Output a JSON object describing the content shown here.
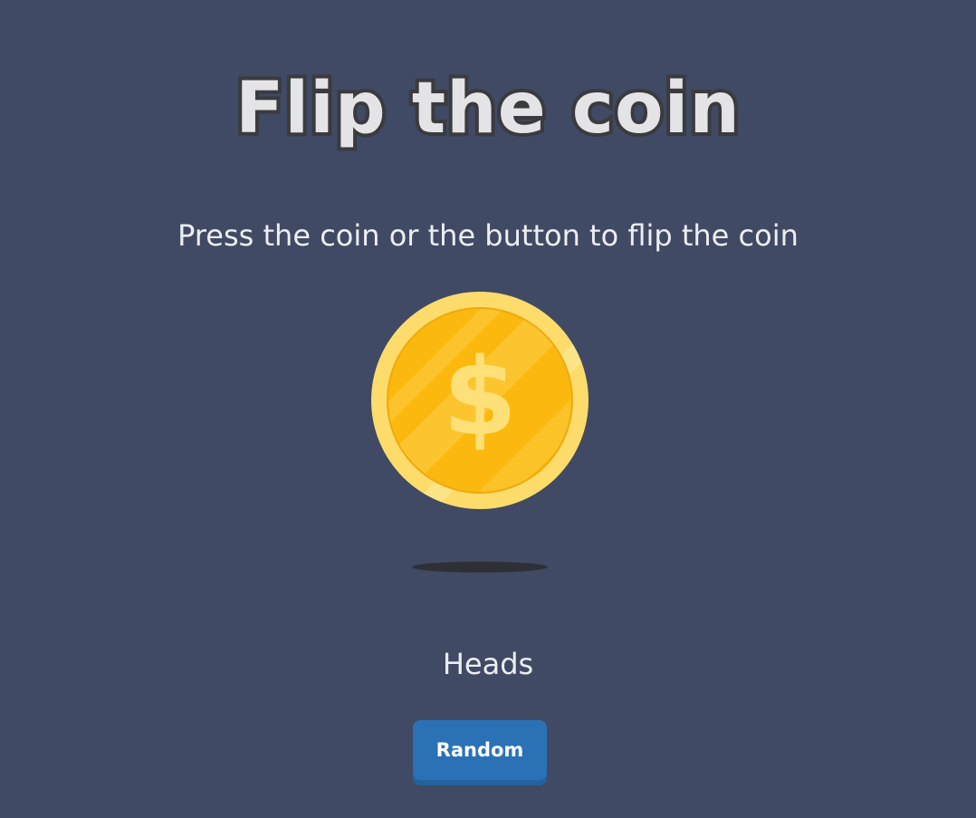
{
  "header": {
    "title": "Flip the coin",
    "subtitle": "Press the coin or the button to flip the coin"
  },
  "coin": {
    "icon": "dollar-coin-icon",
    "symbol": "$",
    "colors": {
      "rim": "#fddc6b",
      "face": "#fbb90f",
      "stripe": "#fcc735",
      "symbol": "#fde077"
    }
  },
  "result": {
    "text": "Heads"
  },
  "controls": {
    "random_label": "Random"
  },
  "colors": {
    "background": "#404a64",
    "button": "#2a72b5",
    "text": "#eceef2"
  }
}
